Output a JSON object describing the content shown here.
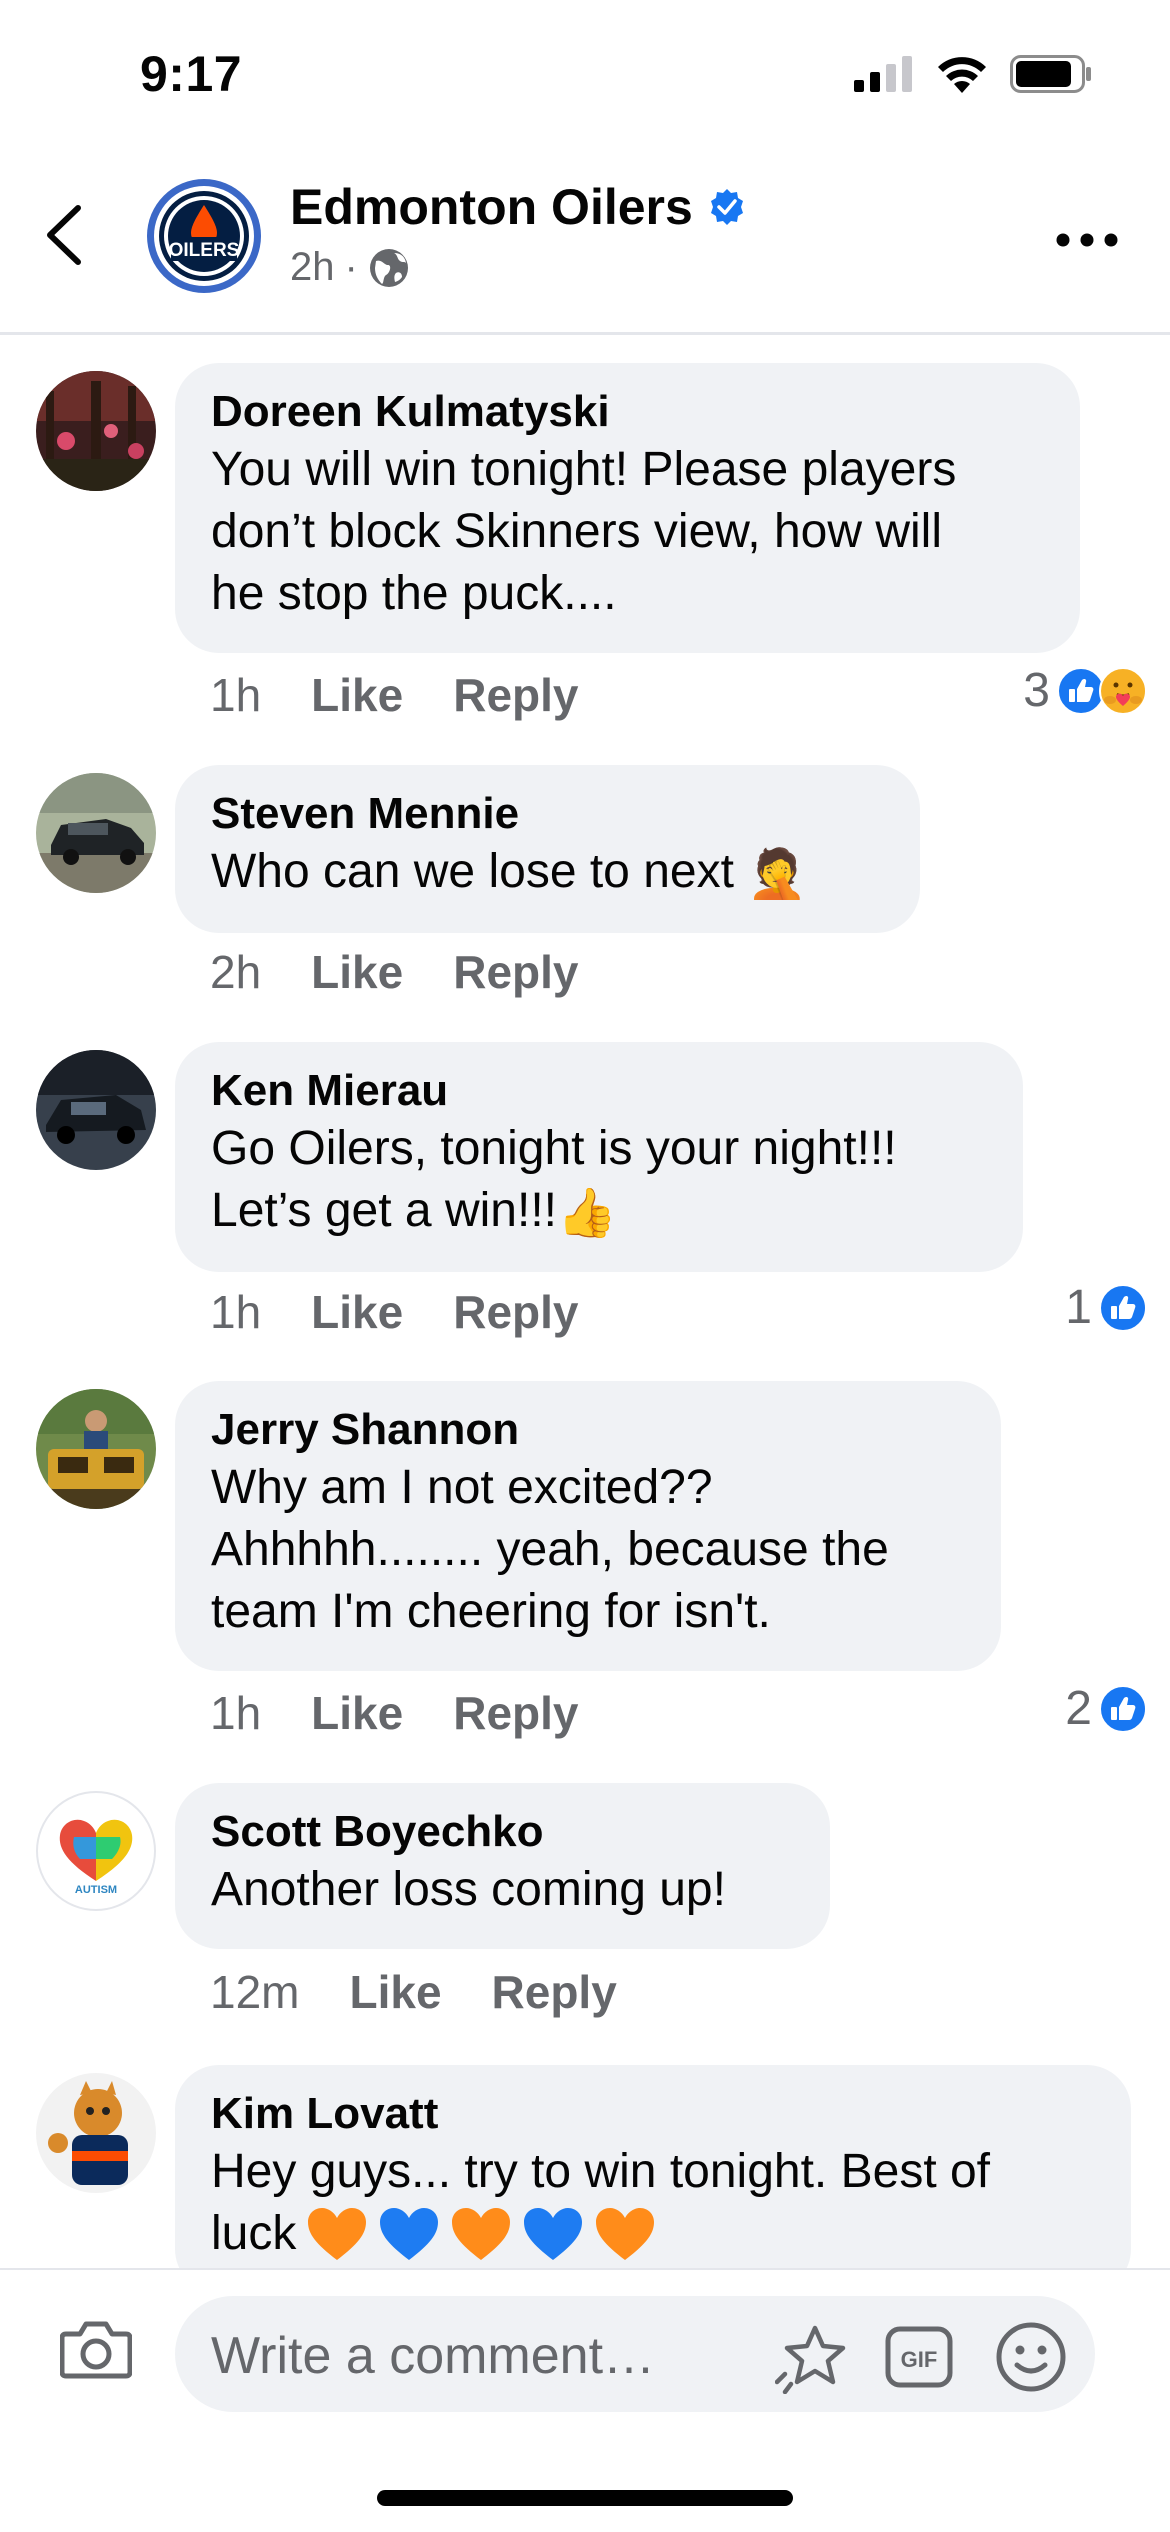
{
  "status_bar": {
    "time": "9:17"
  },
  "header": {
    "page_name": "Edmonton Oilers",
    "post_age": "2h",
    "separator": "·",
    "logo_text": "OILERS"
  },
  "comments": [
    {
      "name": "Doreen Kulmatyski",
      "lines": [
        "You will win tonight! Please players",
        "don’t block Skinners view, how will",
        "he stop the puck...."
      ],
      "time": "1h",
      "like": "Like",
      "reply": "Reply",
      "reaction_count": "3",
      "reactions": [
        "like",
        "care"
      ]
    },
    {
      "name": "Steven Mennie",
      "lines": [
        "Who can we lose to next"
      ],
      "emoji": "🤦",
      "time": "2h",
      "like": "Like",
      "reply": "Reply",
      "reaction_count": "",
      "reactions": []
    },
    {
      "name": "Ken Mierau",
      "lines": [
        "Go Oilers, tonight is your night!!!",
        "Let’s get a win!!!"
      ],
      "emoji": "👍",
      "time": "1h",
      "like": "Like",
      "reply": "Reply",
      "reaction_count": "1",
      "reactions": [
        "like"
      ]
    },
    {
      "name": "Jerry Shannon",
      "lines": [
        "Why am I not excited??",
        "Ahhhhh........ yeah, because the",
        "team I'm cheering for isn't."
      ],
      "time": "1h",
      "like": "Like",
      "reply": "Reply",
      "reaction_count": "2",
      "reactions": [
        "like"
      ]
    },
    {
      "name": "Scott Boyechko",
      "lines": [
        "Another loss coming up!"
      ],
      "time": "12m",
      "like": "Like",
      "reply": "Reply",
      "reaction_count": "",
      "reactions": [],
      "avatar_text": "AUTISM"
    },
    {
      "name": "Kim Lovatt",
      "lines": [
        "Hey guys... try to win tonight. Best of",
        "luck"
      ],
      "hearts": [
        "orange",
        "blue",
        "orange",
        "blue",
        "orange"
      ],
      "time": "",
      "like": "",
      "reply": "",
      "reaction_count": "",
      "reactions": []
    }
  ],
  "composer": {
    "placeholder": "Write a comment…",
    "gif_label": "GIF"
  },
  "colors": {
    "accent": "#1877f2",
    "secondary_text": "#65676b",
    "bubble": "#f0f2f5",
    "oilers_blue": "#041e42",
    "oilers_orange": "#fc4c02"
  },
  "icons": [
    "back-arrow-icon",
    "verified-badge-icon",
    "globe-icon",
    "more-icon",
    "like-reaction-icon",
    "care-reaction-icon",
    "camera-icon",
    "sticker-icon",
    "gif-icon",
    "emoji-icon"
  ]
}
